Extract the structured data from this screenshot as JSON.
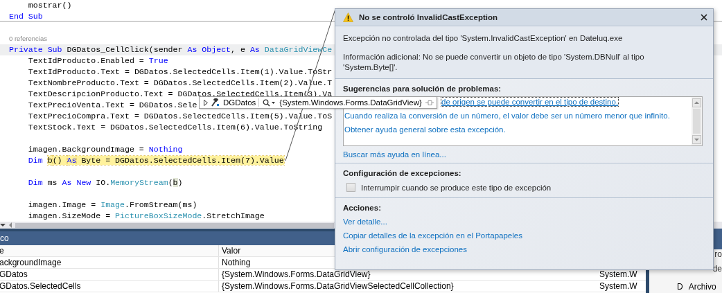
{
  "editor": {
    "lines": [
      {
        "kind": "code",
        "segments": [
          {
            "text": "    mostrar()",
            "kind": "text"
          }
        ]
      },
      {
        "kind": "code",
        "separator_after": true,
        "segments": [
          {
            "text": "End Sub",
            "kind": "kw"
          }
        ]
      },
      {
        "kind": "blank"
      },
      {
        "kind": "lens",
        "segments": [
          {
            "text": "0 referencias",
            "kind": "lens"
          }
        ]
      },
      {
        "kind": "code",
        "shaded": true,
        "segments": [
          {
            "text": "Private Sub",
            "kind": "kw"
          },
          {
            "text": " DGDatos_CellClick(sender ",
            "kind": "text"
          },
          {
            "text": "As Object",
            "kind": "kw"
          },
          {
            "text": ", e ",
            "kind": "text"
          },
          {
            "text": "As",
            "kind": "kw"
          },
          {
            "text": " DataGridViewCe",
            "kind": "type"
          }
        ]
      },
      {
        "kind": "code",
        "segments": [
          {
            "text": "    TextIdProducto.Enabled = ",
            "kind": "text"
          },
          {
            "text": "True",
            "kind": "kw"
          }
        ]
      },
      {
        "kind": "code",
        "segments": [
          {
            "text": "    TextIdProducto.Text = DGDatos.SelectedCells.Item(1).Value.ToStr",
            "kind": "text"
          }
        ]
      },
      {
        "kind": "code",
        "segments": [
          {
            "text": "    TextNombreProducto.Text = DGDatos.SelectedCells.Item(2).Value.T",
            "kind": "text"
          }
        ]
      },
      {
        "kind": "code",
        "segments": [
          {
            "text": "    TextDescripcionProducto.Text = DGDatos.SelectedCells.Item(3).Va",
            "kind": "text"
          }
        ]
      },
      {
        "kind": "code",
        "segments": [
          {
            "text": "    TextPrecioVenta.Text = DGDatos.Sele",
            "kind": "text"
          }
        ]
      },
      {
        "kind": "code",
        "segments": [
          {
            "text": "    TextPrecioCompra.Text = DGDatos.SelectedCells.Item(5).Value.ToS",
            "kind": "text"
          }
        ]
      },
      {
        "kind": "code",
        "segments": [
          {
            "text": "    TextStock.Text = DGDatos.SelectedCells.Item(6).Value.ToString",
            "kind": "text"
          }
        ]
      },
      {
        "kind": "blank"
      },
      {
        "kind": "code",
        "segments": [
          {
            "text": "    imagen.BackgroundImage = ",
            "kind": "text"
          },
          {
            "text": "Nothing",
            "kind": "kw"
          }
        ]
      },
      {
        "kind": "code",
        "segments": [
          {
            "text": "    Dim ",
            "kind": "kw"
          },
          {
            "text": "b",
            "kind": "ref",
            "highlighted": true
          },
          {
            "text": "() ",
            "kind": "text",
            "highlighted": true
          },
          {
            "text": "As",
            "kind": "kw",
            "highlighted": true
          },
          {
            "text": " Byte = DGDatos.SelectedCells.Item(7).Value",
            "kind": "text",
            "highlighted": true
          }
        ]
      },
      {
        "kind": "blank"
      },
      {
        "kind": "code",
        "segments": [
          {
            "text": "    Dim",
            "kind": "kw"
          },
          {
            "text": " ms ",
            "kind": "text"
          },
          {
            "text": "As New",
            "kind": "kw"
          },
          {
            "text": " IO.",
            "kind": "text"
          },
          {
            "text": "MemoryStream",
            "kind": "type"
          },
          {
            "text": "(",
            "kind": "text"
          },
          {
            "text": "b",
            "kind": "ref"
          },
          {
            "text": ")",
            "kind": "text"
          }
        ]
      },
      {
        "kind": "blank"
      },
      {
        "kind": "code",
        "segments": [
          {
            "text": "    imagen.Image = ",
            "kind": "text"
          },
          {
            "text": "Image",
            "kind": "type"
          },
          {
            "text": ".FromStream(ms)",
            "kind": "text"
          }
        ]
      },
      {
        "kind": "code",
        "segments": [
          {
            "text": "    imagen.SizeMode = ",
            "kind": "text"
          },
          {
            "text": "PictureBoxSizeMode",
            "kind": "type"
          },
          {
            "text": ".StretchImage",
            "kind": "text"
          }
        ]
      }
    ]
  },
  "datatip": {
    "name": "DGDatos",
    "value": "{System.Windows.Forms.DataGridView}"
  },
  "locals": {
    "title": "co",
    "columns": [
      "e",
      "Valor"
    ],
    "rows": [
      {
        "name": "ackgroundImage",
        "value": "Nothing"
      },
      {
        "name": "GDatos",
        "value": "{System.Windows.Forms.DataGridView}",
        "type": "System.W"
      },
      {
        "name": "GDatos.SelectedCells",
        "value": "{System.Windows.Forms.DataGridViewSelectedCellCollection}",
        "type": "System.W"
      }
    ]
  },
  "side_panel": {
    "texts": [
      "ro",
      "de"
    ],
    "columns": [
      "D",
      "Archivo"
    ]
  },
  "dialog": {
    "title": "No se controló InvalidCastException",
    "message": "Excepción no controlada del tipo 'System.InvalidCastException' en Dateluq.exe",
    "details": "Información adicional: No se puede convertir un objeto de tipo 'System.DBNull' al tipo 'System.Byte[]'.",
    "suggestions_heading": "Sugerencias para solución de problemas:",
    "suggestions": [
      {
        "text": "de origen se puede convertir en el tipo de destino.",
        "selected": true
      },
      {
        "text": "Cuando realiza la conversión de un número, el valor debe ser un número menor que infinito.",
        "selected": false
      },
      {
        "text": "Obtener ayuda general sobre esta excepción.",
        "selected": false
      }
    ],
    "more_help": "Buscar más ayuda en línea...",
    "settings_heading": "Configuración de excepciones:",
    "break_option": {
      "label": "Interrumpir cuando se produce este tipo de excepción",
      "checked": false
    },
    "actions_heading": "Acciones:",
    "actions": [
      "Ver detalle...",
      "Copiar detalles de la excepción en el Portapapeles",
      "Abrir configuración de excepciones"
    ]
  }
}
